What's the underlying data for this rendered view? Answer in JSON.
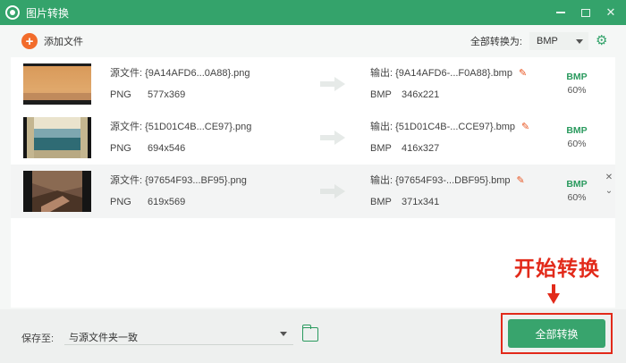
{
  "window": {
    "title": "图片转换"
  },
  "toolbar": {
    "add_label": "添加文件",
    "format_label": "全部转换为:",
    "format_value": "BMP"
  },
  "files": [
    {
      "src_name": "源文件: {9A14AFD6...0A88}.png",
      "src_format": "PNG",
      "src_size": "577x369",
      "out_name": "输出: {9A14AFD6-...F0A88}.bmp",
      "out_format": "BMP",
      "out_size": "346x221",
      "badge_format": "BMP",
      "badge_quality": "60%"
    },
    {
      "src_name": "源文件: {51D01C4B...CE97}.png",
      "src_format": "PNG",
      "src_size": "694x546",
      "out_name": "输出: {51D01C4B-...CCE97}.bmp",
      "out_format": "BMP",
      "out_size": "416x327",
      "badge_format": "BMP",
      "badge_quality": "60%"
    },
    {
      "src_name": "源文件: {97654F93...BF95}.png",
      "src_format": "PNG",
      "src_size": "619x569",
      "out_name": "输出: {97654F93-...DBF95}.bmp",
      "out_format": "BMP",
      "out_size": "371x341",
      "badge_format": "BMP",
      "badge_quality": "60%"
    }
  ],
  "annotation": {
    "text": "开始转换"
  },
  "footer": {
    "save_label": "保存至:",
    "save_path": "与源文件夹一致",
    "convert_label": "全部转换"
  },
  "colors": {
    "accent": "#34a36b",
    "add": "#f26c2b",
    "annotation": "#e22a1a"
  }
}
